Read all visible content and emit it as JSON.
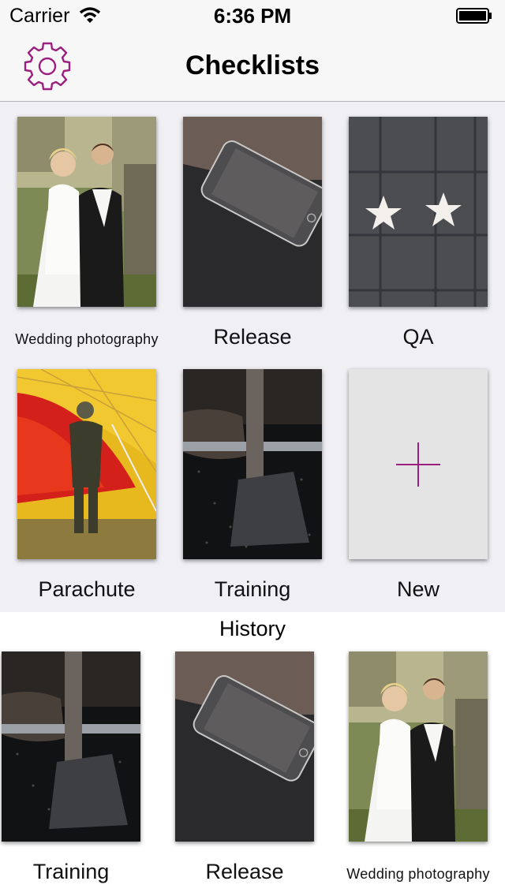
{
  "status_bar": {
    "carrier": "Carrier",
    "time": "6:36 PM"
  },
  "nav": {
    "title": "Checklists"
  },
  "checklists": [
    {
      "label": "Wedding photography",
      "image": "wedding-photo"
    },
    {
      "label": "Release",
      "image": "smartphone-photo"
    },
    {
      "label": "QA",
      "image": "stars-photo"
    },
    {
      "label": "Parachute",
      "image": "parachute-photo"
    },
    {
      "label": "Training",
      "image": "barbell-photo"
    }
  ],
  "new_item": {
    "label": "New",
    "icon": "plus-icon"
  },
  "history": {
    "title": "History",
    "items": [
      {
        "label": "Training",
        "image": "barbell-photo"
      },
      {
        "label": "Release",
        "image": "smartphone-photo"
      },
      {
        "label": "Wedding photography",
        "image": "wedding-photo"
      }
    ]
  },
  "colors": {
    "accent": "#9b1f7f",
    "background": "#efeff4",
    "nav_background": "#f7f7f7"
  }
}
